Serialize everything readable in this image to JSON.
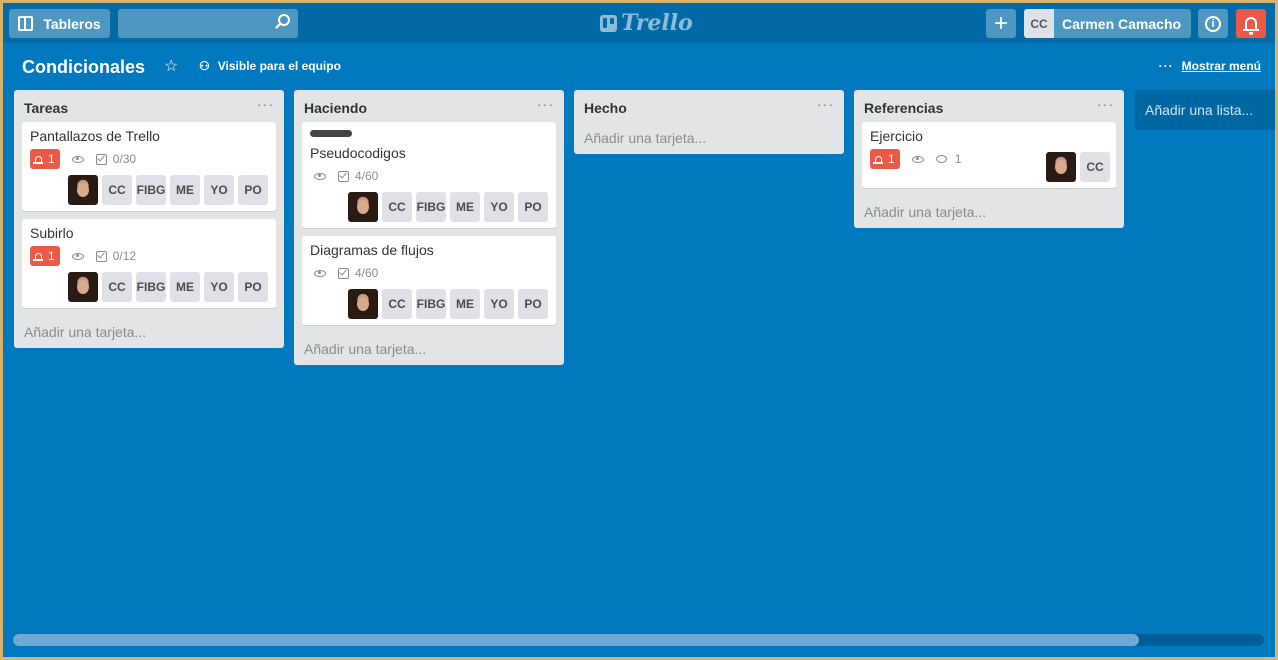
{
  "header": {
    "boards_label": "Tableros",
    "search_placeholder": "",
    "logo_text": "Trello",
    "plus_label": "+",
    "user_initials": "CC",
    "user_name": "Carmen Camacho",
    "info_label": "i"
  },
  "board": {
    "title": "Condicionales",
    "visibility": "Visible para el equipo",
    "menu_dots": "···",
    "show_menu": "Mostrar menú"
  },
  "lists": [
    {
      "name": "Tareas",
      "add_card": "Añadir una tarjeta...",
      "cards": [
        {
          "title": "Pantallazos de Trello",
          "due": "1",
          "checklist": "0/30",
          "members": [
            "CC",
            "FIBG",
            "ME",
            "YO",
            "PO"
          ]
        },
        {
          "title": "Subirlo",
          "due": "1",
          "checklist": "0/12",
          "members": [
            "CC",
            "FIBG",
            "ME",
            "YO",
            "PO"
          ]
        }
      ]
    },
    {
      "name": "Haciendo",
      "add_card": "Añadir una tarjeta...",
      "cards": [
        {
          "title": "Pseudocodigos",
          "checklist": "4/60",
          "members": [
            "CC",
            "FIBG",
            "ME",
            "YO",
            "PO"
          ]
        },
        {
          "title": "Diagramas de flujos",
          "checklist": "4/60",
          "members": [
            "CC",
            "FIBG",
            "ME",
            "YO",
            "PO"
          ]
        }
      ]
    },
    {
      "name": "Hecho",
      "add_card": "Añadir una tarjeta...",
      "cards": []
    },
    {
      "name": "Referencias",
      "add_card": "Añadir una tarjeta...",
      "cards": [
        {
          "title": "Ejercicio",
          "due": "1",
          "comments": "1",
          "members": [
            "CC"
          ]
        }
      ]
    }
  ],
  "add_list": "Añadir una lista...",
  "more_dots": "···",
  "colors": {
    "background": "#0079bf",
    "topbar": "#026aa7",
    "due_badge": "#eb5a46",
    "list_bg": "#e2e4e6"
  }
}
